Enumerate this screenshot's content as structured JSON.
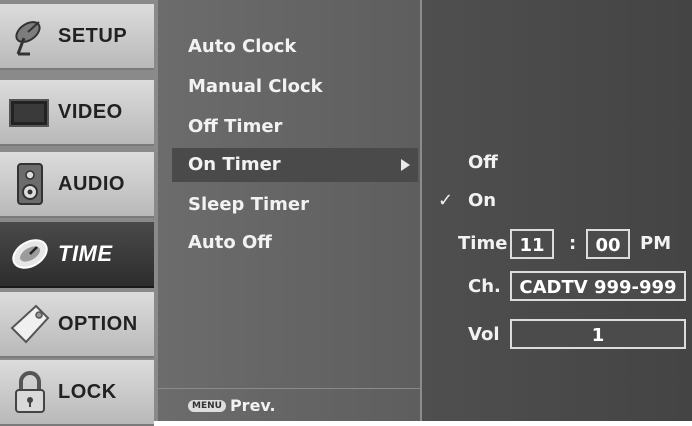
{
  "tabs": [
    {
      "label": "SETUP",
      "icon": "satellite-dish-icon",
      "active": false
    },
    {
      "label": "VIDEO",
      "icon": "tv-screen-icon",
      "active": false
    },
    {
      "label": "AUDIO",
      "icon": "speaker-icon",
      "active": false
    },
    {
      "label": "TIME",
      "icon": "clock-icon",
      "active": true
    },
    {
      "label": "OPTION",
      "icon": "tag-icon",
      "active": false
    },
    {
      "label": "LOCK",
      "icon": "padlock-icon",
      "active": false
    }
  ],
  "submenu": {
    "items": [
      {
        "label": "Auto Clock"
      },
      {
        "label": "Manual Clock"
      },
      {
        "label": "Off Timer"
      },
      {
        "label": "On Timer",
        "selected": true
      },
      {
        "label": "Sleep Timer"
      },
      {
        "label": "Auto Off"
      }
    ],
    "footer": {
      "key": "MENU",
      "label": "Prev."
    }
  },
  "on_timer": {
    "options": [
      {
        "label": "Off",
        "checked": false
      },
      {
        "label": "On",
        "checked": true
      }
    ],
    "check_mark": "✓",
    "time": {
      "label": "Time",
      "hour": "11",
      "separator": ":",
      "minute": "00",
      "ampm": "PM"
    },
    "channel": {
      "label": "Ch.",
      "value": "CADTV 999-999"
    },
    "volume": {
      "label": "Vol",
      "value": "1"
    }
  }
}
